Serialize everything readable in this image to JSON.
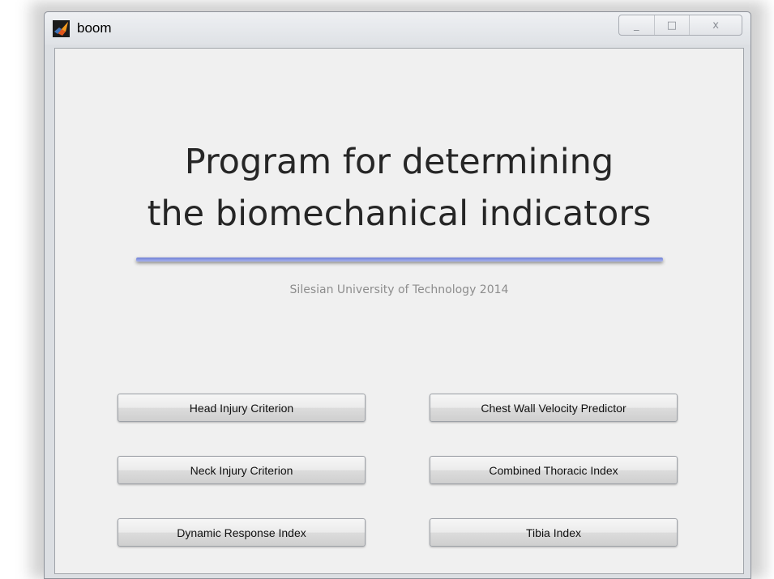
{
  "window": {
    "title": "boom",
    "controls": {
      "minimize": "_",
      "maximize": "□",
      "close": "x"
    }
  },
  "main": {
    "title_line1": "Program for determining",
    "title_line2": "the biomechanical indicators",
    "subtitle": "Silesian University of Technology 2014",
    "divider_color": "#8a96e4"
  },
  "buttons": {
    "hic": "Head Injury Criterion",
    "cwvp": "Chest Wall Velocity Predictor",
    "nic": "Neck Injury Criterion",
    "cti": "Combined Thoracic Index",
    "dri": "Dynamic Response Index",
    "tibia": "Tibia Index"
  },
  "icons": {
    "app": "matlab-icon"
  }
}
